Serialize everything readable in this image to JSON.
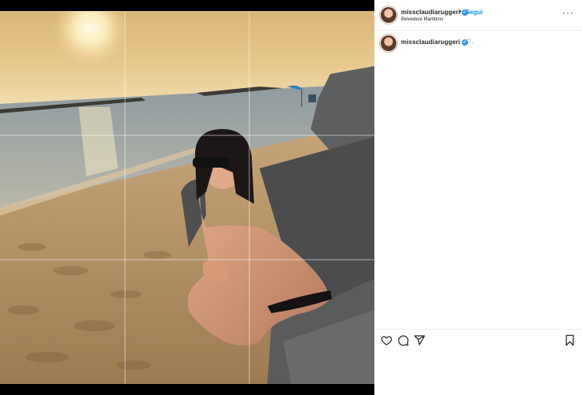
{
  "post": {
    "username": "missclaudiaruggeri",
    "verified_mark": "✓",
    "separator": "•",
    "follow_label": "Segui",
    "location": "Belvedere Marittimo",
    "more_label": "···",
    "caption_text": "♡."
  },
  "icons": {
    "heart": "heart-icon",
    "comment": "comment-icon",
    "share": "share-icon",
    "save": "bookmark-icon",
    "more": "more-options-icon",
    "verified": "verified-badge-icon"
  },
  "colors": {
    "link_blue": "#0095f6",
    "verified_blue": "#3897f0",
    "text": "#262626",
    "background": "#ffffff"
  }
}
